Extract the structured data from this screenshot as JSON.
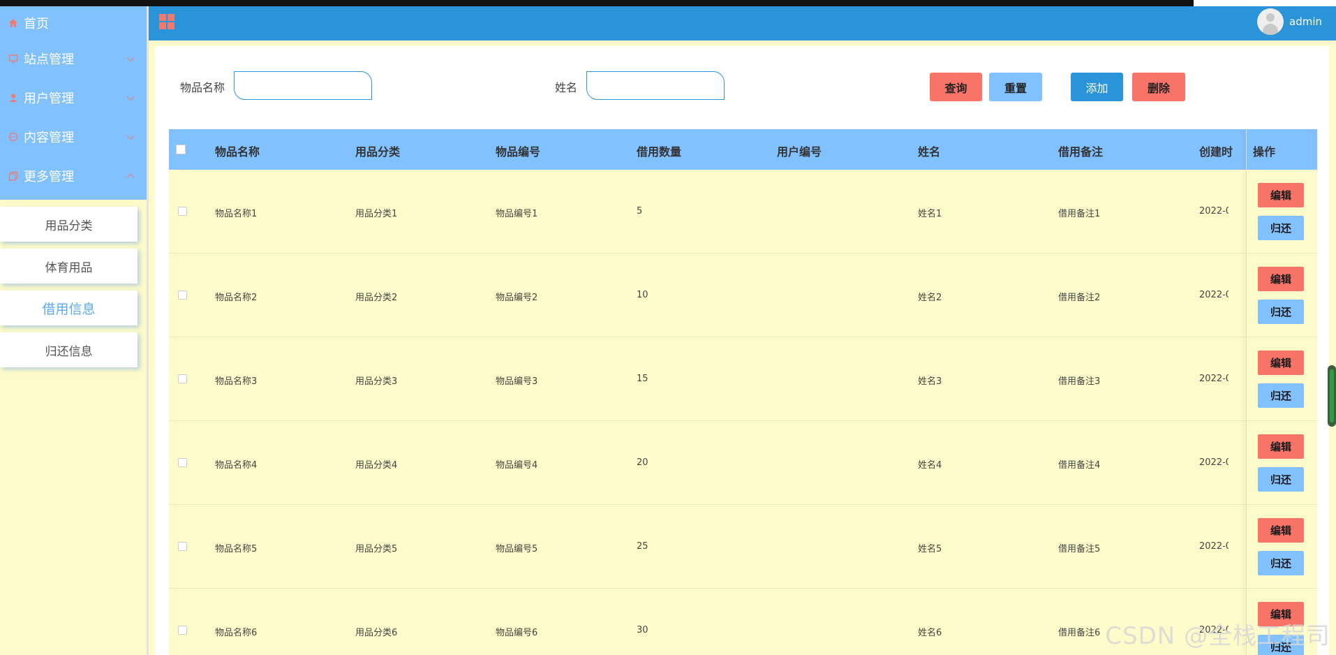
{
  "sidebar": {
    "menu": [
      {
        "label": "首页",
        "icon": "home-icon"
      },
      {
        "label": "站点管理",
        "icon": "monitor-icon"
      },
      {
        "label": "用户管理",
        "icon": "user-icon"
      },
      {
        "label": "内容管理",
        "icon": "chat-icon"
      },
      {
        "label": "更多管理",
        "icon": "copy-icon"
      }
    ],
    "submenu": [
      "用品分类",
      "体育用品",
      "借用信息",
      "归还信息"
    ],
    "active_submenu": "借用信息"
  },
  "header": {
    "user_name": "admin"
  },
  "search": {
    "item_name_label": "物品名称",
    "name_label": "姓名",
    "item_name_value": "",
    "name_value": "",
    "query_label": "查询",
    "reset_label": "重置",
    "add_label": "添加",
    "delete_label": "删除"
  },
  "table": {
    "columns": [
      "物品名称",
      "用品分类",
      "物品编号",
      "借用数量",
      "用户编号",
      "姓名",
      "借用备注",
      "创建时",
      "操作"
    ],
    "rows": [
      {
        "item_name": "物品名称1",
        "category": "用品分类1",
        "item_no": "物品编号1",
        "qty": "5",
        "user_no": "",
        "name": "姓名1",
        "remark": "借用备注1",
        "created": "2022-0"
      },
      {
        "item_name": "物品名称2",
        "category": "用品分类2",
        "item_no": "物品编号2",
        "qty": "10",
        "user_no": "",
        "name": "姓名2",
        "remark": "借用备注2",
        "created": "2022-0"
      },
      {
        "item_name": "物品名称3",
        "category": "用品分类3",
        "item_no": "物品编号3",
        "qty": "15",
        "user_no": "",
        "name": "姓名3",
        "remark": "借用备注3",
        "created": "2022-0"
      },
      {
        "item_name": "物品名称4",
        "category": "用品分类4",
        "item_no": "物品编号4",
        "qty": "20",
        "user_no": "",
        "name": "姓名4",
        "remark": "借用备注4",
        "created": "2022-0"
      },
      {
        "item_name": "物品名称5",
        "category": "用品分类5",
        "item_no": "物品编号5",
        "qty": "25",
        "user_no": "",
        "name": "姓名5",
        "remark": "借用备注5",
        "created": "2022-0"
      },
      {
        "item_name": "物品名称6",
        "category": "用品分类6",
        "item_no": "物品编号6",
        "qty": "30",
        "user_no": "",
        "name": "姓名6",
        "remark": "借用备注6",
        "created": "2022-0"
      }
    ],
    "edit_label": "编辑",
    "return_label": "归还"
  },
  "watermark": "CSDN @全栈工程司",
  "colors": {
    "header": "#2b93d7",
    "sidebar_menu": "#82c1ff",
    "body_bg": "#fdfbc9",
    "accent_red": "#f97468",
    "accent_light_blue": "#82c1ff"
  }
}
